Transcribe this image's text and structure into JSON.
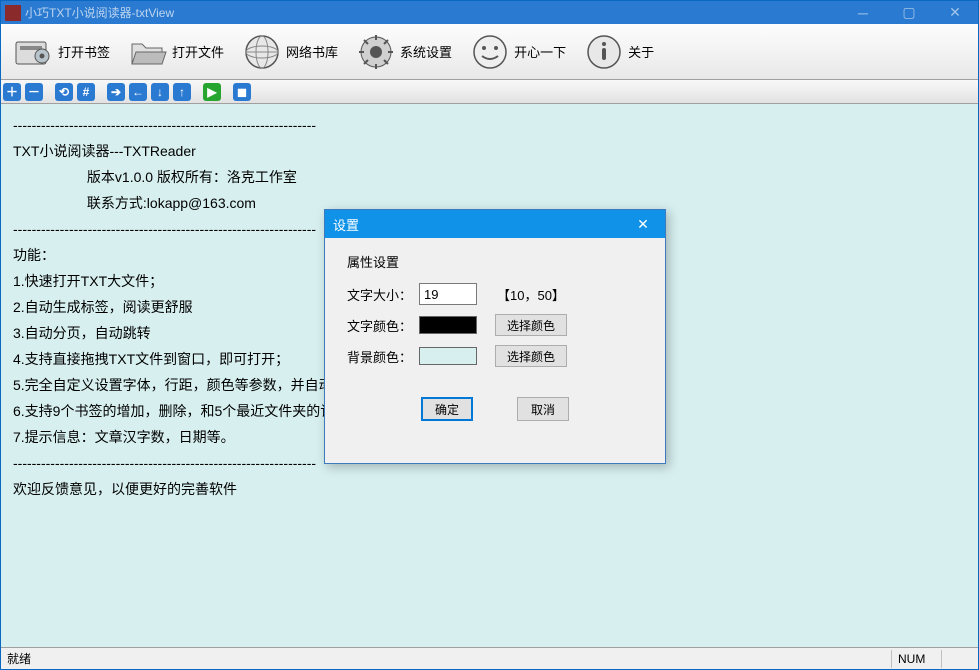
{
  "window": {
    "title": "小巧TXT小说阅读器-txtView"
  },
  "toolbar": {
    "items": [
      {
        "label": "打开书签",
        "icon": "open-bookmark-icon"
      },
      {
        "label": "打开文件",
        "icon": "open-file-icon"
      },
      {
        "label": "网络书库",
        "icon": "web-library-icon"
      },
      {
        "label": "系统设置",
        "icon": "settings-icon"
      },
      {
        "label": "开心一下",
        "icon": "smile-icon"
      },
      {
        "label": "关于",
        "icon": "about-icon"
      }
    ]
  },
  "secondary": {
    "icons": [
      "plus",
      "minus",
      "sep",
      "home",
      "hash",
      "sep",
      "right",
      "left",
      "down",
      "up",
      "sep",
      "play",
      "sep",
      "stop"
    ]
  },
  "content": {
    "lines": [
      "-----------------------------------------------------------------",
      "TXT小说阅读器---TXTReader",
      "                   版本v1.0.0 版权所有：洛克工作室",
      "                   联系方式:lokapp@163.com",
      "-----------------------------------------------------------------",
      "功能：",
      "1.快速打开TXT大文件；",
      "2.自动生成标签，阅读更舒服",
      "3.自动分页，自动跳转",
      "4.支持直接拖拽TXT文件到窗口，即可打开；",
      "5.完全自定义设置字体，行距，颜色等参数，并自动保",
      "6.支持9个书签的增加，删除，和5个最近文件夹的记录",
      "7.提示信息：文章汉字数，日期等。",
      "",
      "-----------------------------------------------------------------",
      "欢迎反馈意见，以便更好的完善软件"
    ]
  },
  "dialog": {
    "title": "设置",
    "group_label": "属性设置",
    "font_size_label": "文字大小：",
    "font_size_value": "19",
    "font_size_hint": "【10，50】",
    "font_color_label": "文字颜色：",
    "bg_color_label": "背景颜色：",
    "pick_label": "选择颜色",
    "ok_label": "确定",
    "cancel_label": "取消"
  },
  "status": {
    "ready": "就绪",
    "num": "NUM"
  }
}
